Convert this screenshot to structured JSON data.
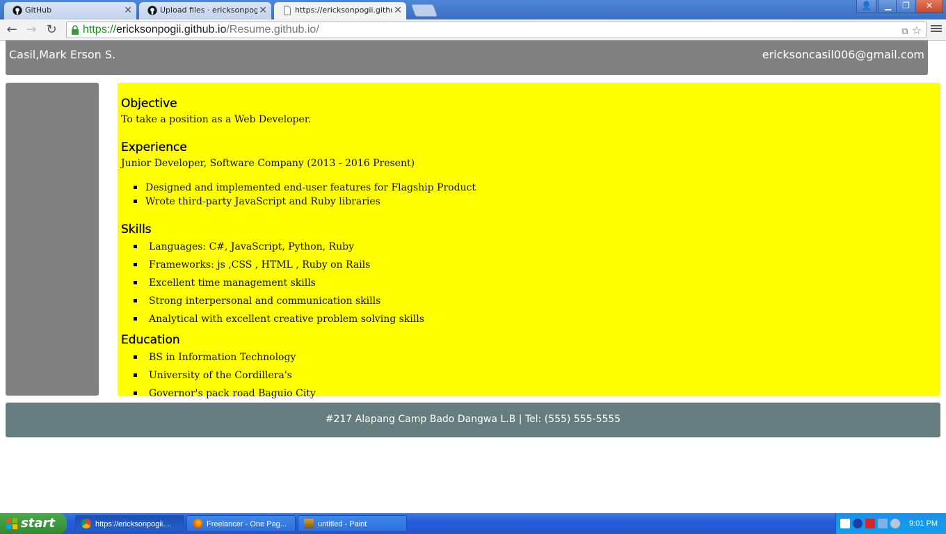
{
  "browser": {
    "tabs": [
      {
        "label": "GitHub",
        "icon": "github-icon"
      },
      {
        "label": "Upload files · ericksonpogii/C",
        "icon": "github-icon"
      },
      {
        "label": "https://ericksonpogii.github.i",
        "icon": "page-icon",
        "active": true
      }
    ],
    "url": {
      "scheme": "https://",
      "host": "ericksonpogii.github.io",
      "path": "/Resume.github.io/"
    }
  },
  "page": {
    "header": {
      "name": "Casil,Mark Erson S.",
      "email": "ericksoncasil006@gmail.com"
    },
    "objective": {
      "heading": "Objective",
      "text": "To take a position as a Web Developer."
    },
    "experience": {
      "heading": "Experience",
      "position": "Junior Developer, Software Company (2013 - 2016 Present)",
      "items": [
        "Designed and implemented end-user features for Flagship Product",
        "Wrote third-party JavaScript and Ruby libraries"
      ]
    },
    "skills": {
      "heading": "Skills",
      "items": [
        "Languages: C#, JavaScript, Python, Ruby",
        "Frameworks: js ,CSS , HTML , Ruby on Rails",
        "Excellent time management skills",
        "Strong interpersonal and communication skills",
        "Analytical with excellent creative problem solving skills"
      ]
    },
    "education": {
      "heading": "Education",
      "items": [
        "BS in Information Technology",
        "University of the Cordillera's",
        "Governor's pack road Baguio City"
      ]
    },
    "footer": "#217 Alapang Camp Bado Dangwa L.B | Tel: (555) 555-5555"
  },
  "taskbar": {
    "start_label": "start",
    "tasks": [
      {
        "label": "https://ericksonpogii....",
        "icon": "chrome-icon",
        "active": true
      },
      {
        "label": "Freelancer - One Pag...",
        "icon": "firefox-icon"
      },
      {
        "label": "untitled - Paint",
        "icon": "paint-icon"
      }
    ],
    "clock": "9:01 PM"
  },
  "colors": {
    "header_bg": "#808080",
    "main_bg": "#ffff00",
    "footer_bg": "#667d80"
  }
}
